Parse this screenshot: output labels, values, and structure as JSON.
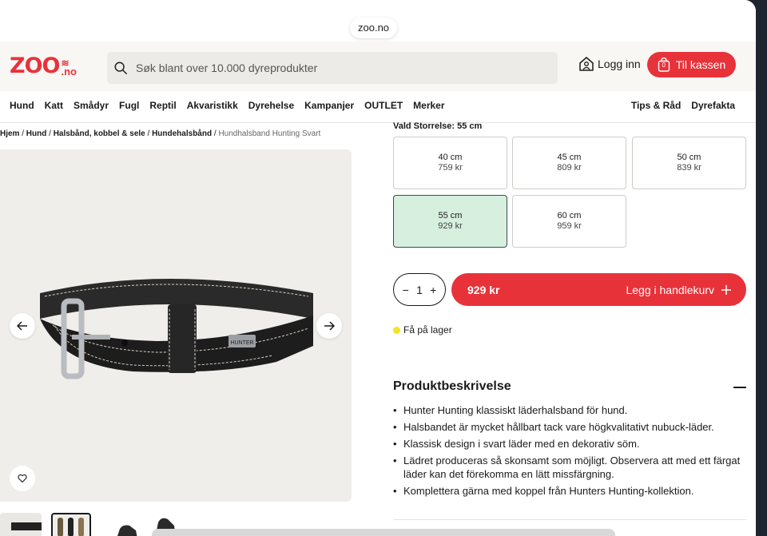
{
  "browser": {
    "url": "zoo.no"
  },
  "header": {
    "logo_main": "ZOO",
    "logo_suffix": ".no",
    "search_placeholder": "Søk blant over 10.000 dyreprodukter",
    "login_label": "Logg inn",
    "checkout_label": "Til kassen",
    "cart_count": "0"
  },
  "nav": {
    "left": [
      "Hund",
      "Katt",
      "Smådyr",
      "Fugl",
      "Reptil",
      "Akvaristikk",
      "Dyrehelse",
      "Kampanjer",
      "OUTLET",
      "Merker"
    ],
    "right": [
      "Tips & Råd",
      "Dyrefakta"
    ]
  },
  "breadcrumb": {
    "items": [
      "Hjem",
      "Hund",
      "Halsbånd, kobbel & sele",
      "Hundehalsbånd"
    ],
    "current": "Hundhalsband Hunting Svart"
  },
  "product": {
    "size_label": "Vald Storrelse: 55 cm",
    "sizes": [
      {
        "size": "40 cm",
        "price": "759 kr",
        "selected": false
      },
      {
        "size": "45 cm",
        "price": "809 kr",
        "selected": false
      },
      {
        "size": "50 cm",
        "price": "839 kr",
        "selected": false
      },
      {
        "size": "55 cm",
        "price": "929 kr",
        "selected": true
      },
      {
        "size": "60 cm",
        "price": "959 kr",
        "selected": false
      }
    ],
    "quantity": "1",
    "cart_price": "929 kr",
    "cart_label": "Legg i handlekurv",
    "stock_text": "Få på lager",
    "stock_color": "#f4e32a",
    "accent_color": "#e8323a",
    "selected_bg": "#d6efdf",
    "collar_brand_tag": "HUNTER"
  },
  "description": {
    "heading": "Produktbeskrivelse",
    "bullets": [
      "Hunter Hunting klassiskt läderhalsband för hund.",
      "Halsbandet är mycket hållbart tack vare högkvalitativt nubuck-läder.",
      "Klassisk design i svart läder med en dekorativ söm.",
      "Lädret produceras så skonsamt som möjligt. Observera att med ett färgat läder kan det förekomma en lätt missfärgning.",
      "Komplettera gärna med koppel från Hunters Hunting-kollektion."
    ]
  }
}
